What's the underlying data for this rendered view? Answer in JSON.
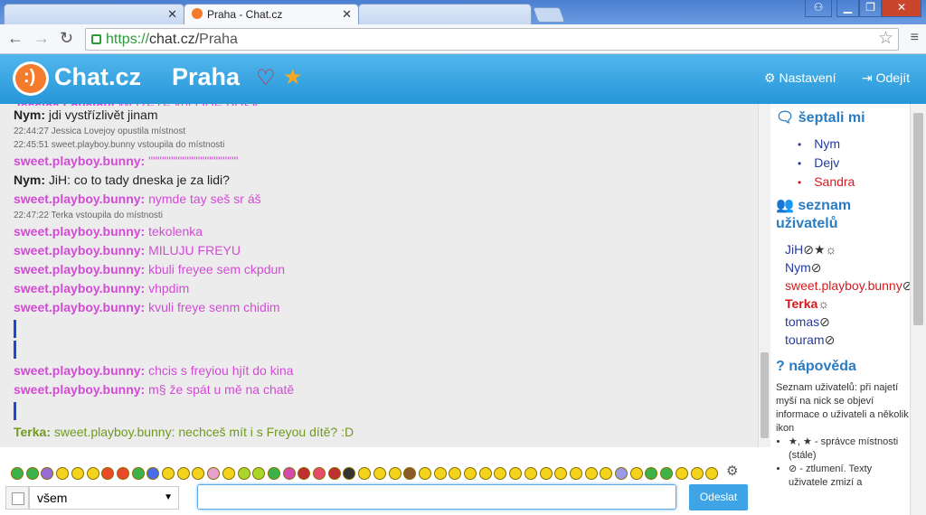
{
  "browser": {
    "tabs": [
      {
        "label": "",
        "active": false
      },
      {
        "label": "Praha - Chat.cz",
        "active": true
      },
      {
        "label": "",
        "active": false
      }
    ],
    "url_scheme": "https://",
    "url_host": "chat.cz/",
    "url_path": "Praha"
  },
  "header": {
    "logo": "Chat.cz",
    "room": "Praha",
    "settings": "Nastavení",
    "logout": "Odejít"
  },
  "chat": {
    "lines": [
      {
        "type": "msg",
        "nick": "Nym:",
        "text": "jdi vystřízlivět jinam",
        "color": "blk"
      },
      {
        "type": "sys",
        "text": "22:44:27 Jessica Lovejoy opustila místnost"
      },
      {
        "type": "sys",
        "text": "22:45:51 sweet.playboy.bunny vstoupila do místnosti"
      },
      {
        "type": "msg",
        "nick": "sweet.playboy.bunny:",
        "text": "\"\"\"\"\"\"\"\"\"\"\"\"\"\"\"\"\"\"\"\"",
        "color": "pink"
      },
      {
        "type": "msg",
        "nick": "Nym:",
        "text": "JiH: co to tady dneska je za lidi?",
        "color": "blk"
      },
      {
        "type": "msg",
        "nick": "sweet.playboy.bunny:",
        "text": "nymde tay seš sr áš",
        "color": "pink"
      },
      {
        "type": "sys",
        "text": "22:47:22 Terka vstoupila do místnosti"
      },
      {
        "type": "msg",
        "nick": "sweet.playboy.bunny:",
        "text": "tekolenka",
        "color": "pink"
      },
      {
        "type": "msg",
        "nick": "sweet.playboy.bunny:",
        "text": "MILUJU FREYU",
        "color": "pink"
      },
      {
        "type": "msg",
        "nick": "sweet.playboy.bunny:",
        "text": "kbuli freyee sem ckpdun",
        "color": "pink"
      },
      {
        "type": "msg",
        "nick": "sweet.playboy.bunny:",
        "text": "vhpdim",
        "color": "pink"
      },
      {
        "type": "msg",
        "nick": "sweet.playboy.bunny:",
        "text": "kvuli freye senm chidim",
        "color": "pink"
      },
      {
        "type": "bar"
      },
      {
        "type": "bar"
      },
      {
        "type": "msg",
        "nick": "sweet.playboy.bunny:",
        "text": "chcis s freyiou hjít do kina",
        "color": "pink"
      },
      {
        "type": "msg",
        "nick": "sweet.playboy.bunny:",
        "text": "m§ že spát u mě na chatě",
        "color": "pink"
      },
      {
        "type": "bar"
      },
      {
        "type": "msg",
        "nick": "Terka:",
        "text": "sweet.playboy.bunny: nechceš mít i s Freyou dítě? :D",
        "color": "olive"
      }
    ]
  },
  "sidebar": {
    "whisper_title": "šeptali mi",
    "whispers": [
      {
        "name": "Nym",
        "color": "blue"
      },
      {
        "name": "Dejv",
        "color": "blue"
      },
      {
        "name": "Sandra",
        "color": "red"
      }
    ],
    "users_title": "seznam uživatelů",
    "users": [
      {
        "name": "JiH",
        "color": "#223ca0",
        "icons": "⊘★☼"
      },
      {
        "name": "Nym",
        "color": "#223ca0",
        "icons": "⊘"
      },
      {
        "name": "sweet.playboy.bunny",
        "color": "#d8191c",
        "icons": "⊘"
      },
      {
        "name": "Terka",
        "color": "#d8191c",
        "icons": "☼"
      },
      {
        "name": "tomas",
        "color": "#223ca0",
        "icons": "⊘"
      },
      {
        "name": "touram",
        "color": "#223ca0",
        "icons": "⊘"
      }
    ],
    "help_title": "nápověda",
    "help_text": "Seznam uživatelů: při najetí myší na nick se objeví informace o uživateli a několik ikon",
    "help_items": [
      "★, ★ - správce místnosti (stále)",
      "⊘ - ztlumení. Texty uživatele zmizí a"
    ]
  },
  "input": {
    "target": "všem",
    "placeholder": "",
    "send": "Odeslat"
  },
  "colors": {
    "accent": "#2596d8",
    "pink": "#d34ad6",
    "olive": "#6f9a1e"
  }
}
